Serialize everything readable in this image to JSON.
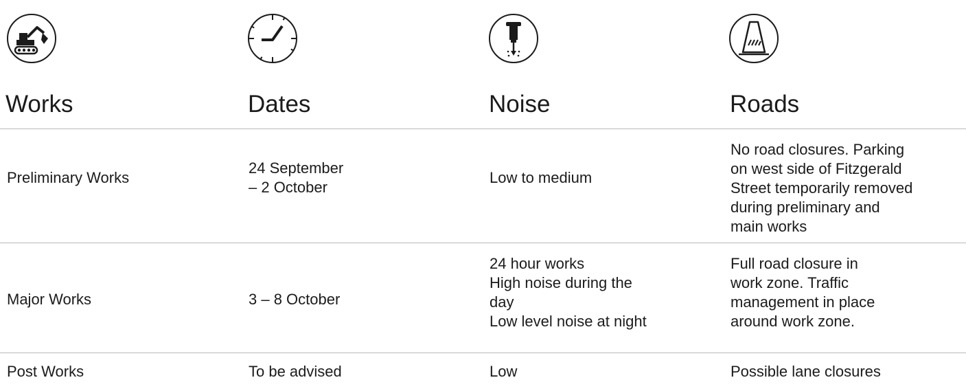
{
  "columns": [
    {
      "icon": "excavator-icon",
      "label": "Works"
    },
    {
      "icon": "clock-icon",
      "label": "Dates"
    },
    {
      "icon": "jackhammer-icon",
      "label": "Noise"
    },
    {
      "icon": "traffic-cone-icon",
      "label": "Roads"
    }
  ],
  "rows": [
    {
      "works": "Preliminary Works",
      "dates": "24 September\n– 2 October",
      "noise": "Low to medium",
      "roads": "No road closures. Parking\non west side of Fitzgerald\nStreet temporarily removed\nduring preliminary and\nmain works"
    },
    {
      "works": "Major Works",
      "dates": "3 – 8 October",
      "noise": "24 hour works\nHigh noise during the\nday\nLow level noise at night",
      "roads": "Full road closure in\nwork zone. Traffic\nmanagement in place\naround work zone."
    },
    {
      "works": "Post Works",
      "dates": "To be advised",
      "noise": "Low",
      "roads": "Possible lane closures"
    }
  ]
}
